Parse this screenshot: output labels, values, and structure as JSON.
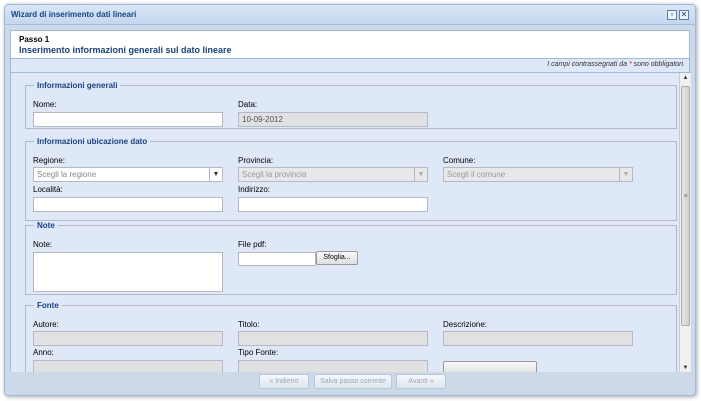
{
  "window": {
    "title": "Wizard di inserimento dati lineari",
    "max_icon": "maximize-icon",
    "close_icon": "close-icon"
  },
  "step": {
    "number": "Passo 1",
    "title": "Inserimento informazioni generali sul dato lineare"
  },
  "required_note": {
    "prefix": "I campi contrassegnati da",
    "star": "*",
    "suffix": "sono obbligatori."
  },
  "general": {
    "legend": "Informazioni generali",
    "name_label": "Nome:",
    "name_value": "",
    "date_label": "Data:",
    "date_value": "10-09-2012"
  },
  "location": {
    "legend": "Informazioni ubicazione dato",
    "region_label": "Regione:",
    "region_placeholder": "Scegli la regione",
    "province_label": "Provincia:",
    "province_placeholder": "Scegli la provincia",
    "comune_label": "Comune:",
    "comune_placeholder": "Scegli il comune",
    "locality_label": "Località:",
    "address_label": "Indirizzo:"
  },
  "notes": {
    "legend": "Note",
    "notes_label": "Note:",
    "pdf_label": "File pdf:",
    "browse_label": "Sfoglia..."
  },
  "source": {
    "legend": "Fonte",
    "author_label": "Autore:",
    "title_label": "Titolo:",
    "description_label": "Descrizione:",
    "year_label": "Anno:",
    "type_label": "Tipo Fonte:"
  },
  "footer": {
    "back_label": "« Indietro",
    "save_label": "Salva passo corrente",
    "next_label": "Avanti »"
  },
  "scrollbar": {
    "grip": "≡"
  }
}
